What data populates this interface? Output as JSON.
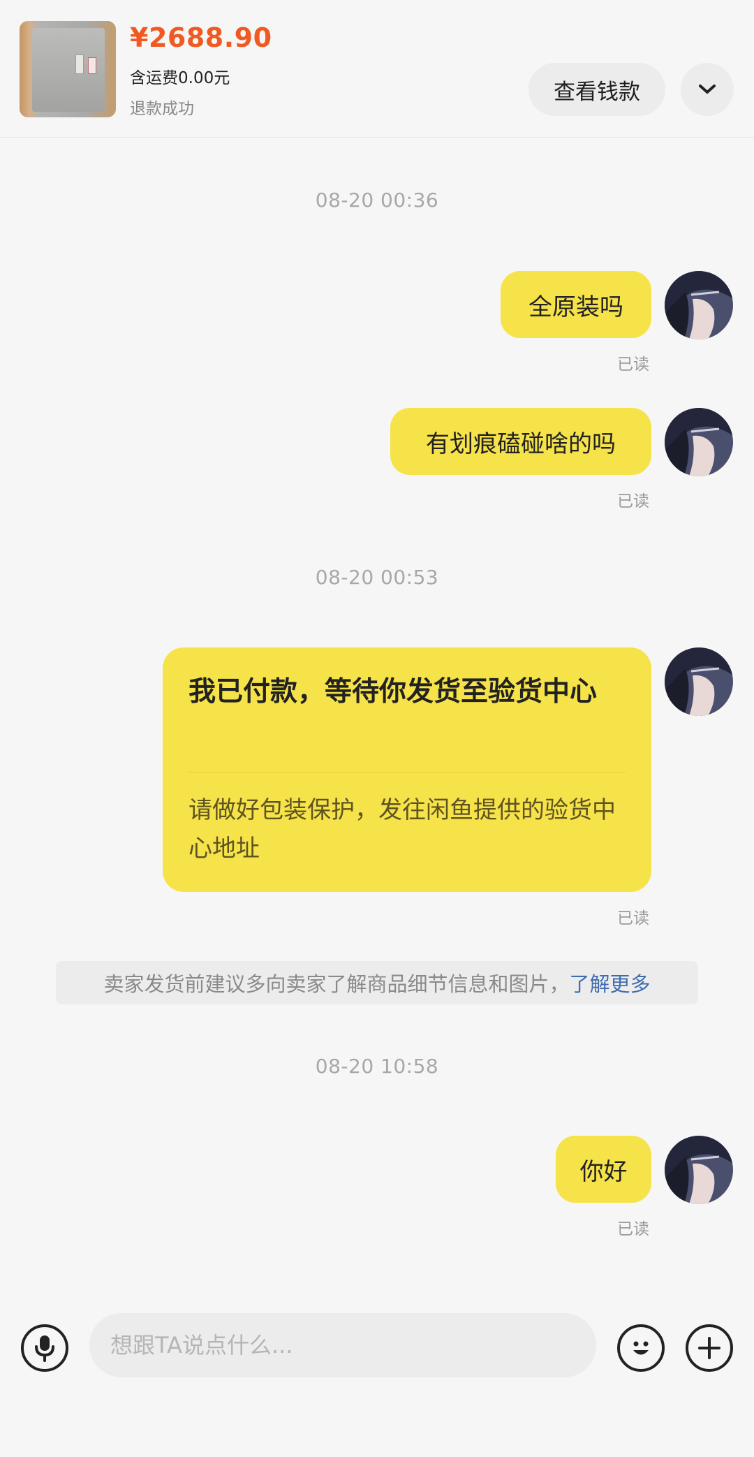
{
  "header": {
    "price": "¥2688.90",
    "shipping": "含运费0.00元",
    "status": "退款成功",
    "view_button": "查看钱款",
    "expand_icon": "chevron-down-icon"
  },
  "messages": {
    "ts1": "08-20 00:36",
    "m1": "全原装吗",
    "m1_read": "已读",
    "m2": "有划痕磕碰啥的吗",
    "m2_read": "已读",
    "ts2": "08-20 00:53",
    "card_title": "我已付款，等待你发货至验货中心",
    "card_body": "请做好包装保护，发往闲鱼提供的验货中心地址",
    "card_read": "已读",
    "notice_text": "卖家发货前建议多向卖家了解商品细节信息和图片，",
    "notice_link": "了解更多",
    "ts3": "08-20 10:58",
    "m3": "你好",
    "m3_read": "已读"
  },
  "input_bar": {
    "placeholder": "想跟TA说点什么...",
    "voice_icon": "microphone-icon",
    "emoji_icon": "emoji-icon",
    "plus_icon": "plus-icon"
  },
  "colors": {
    "price": "#f05a22",
    "bubble": "#f6e249",
    "link": "#3f6cb0",
    "background": "#f6f6f6"
  }
}
